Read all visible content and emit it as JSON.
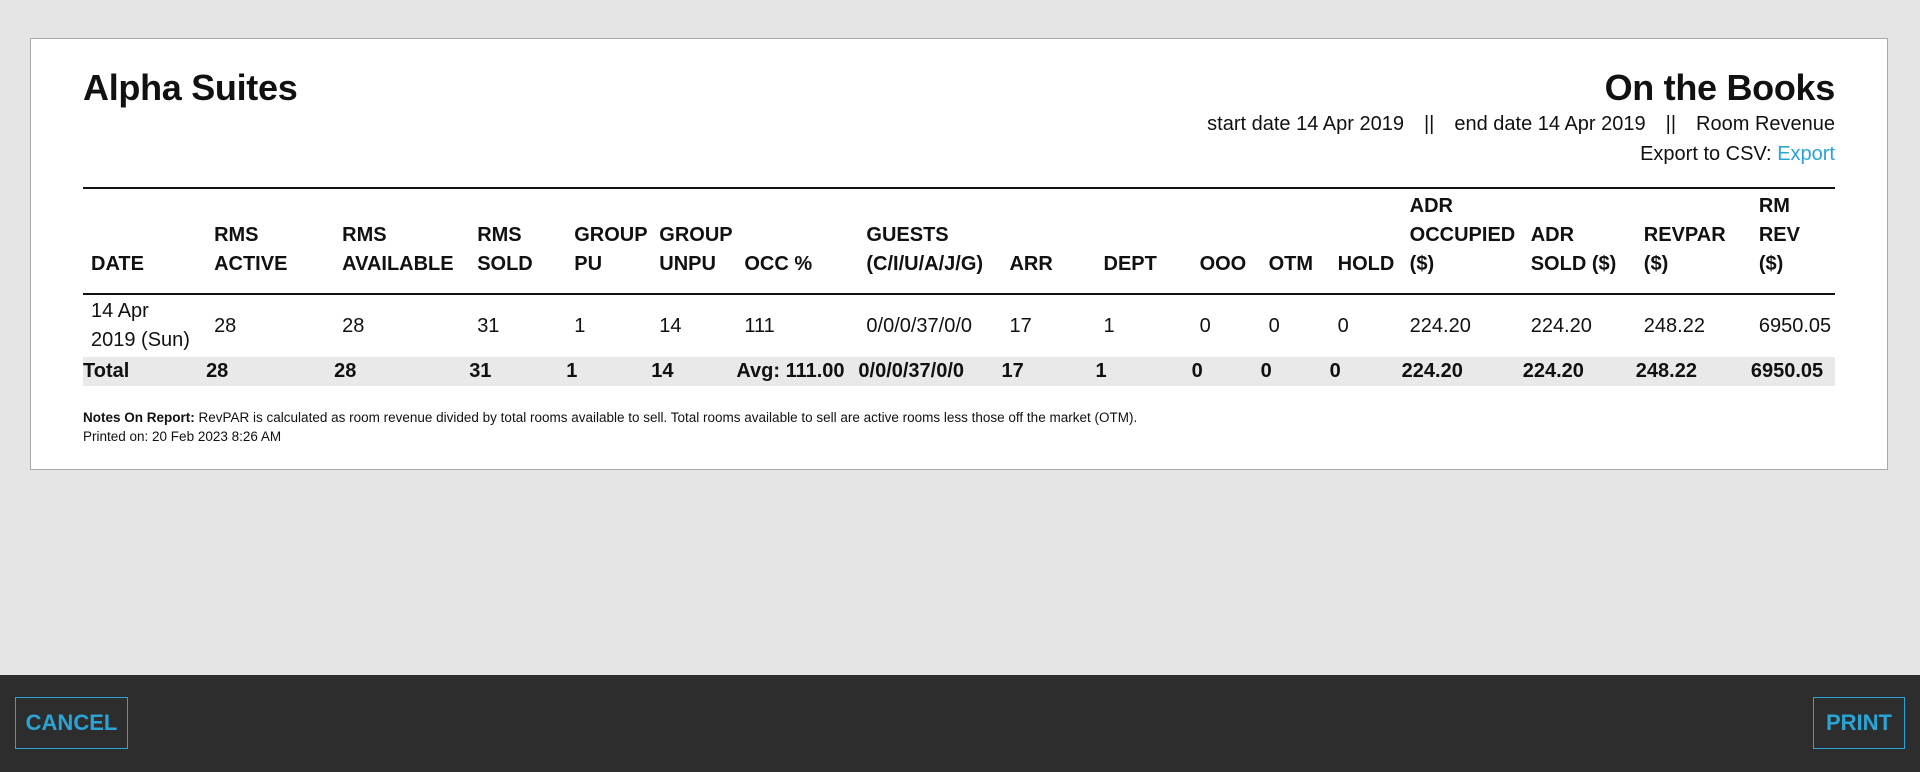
{
  "report": {
    "hotel_name": "Alpha Suites",
    "title": "On the Books",
    "start_date_label": "start date 14 Apr 2019",
    "end_date_label": "end date 14 Apr 2019",
    "revenue_type": "Room Revenue",
    "separator": "||",
    "export_label": "Export to CSV:",
    "export_link": "Export"
  },
  "table": {
    "headers": [
      [
        "DATE"
      ],
      [
        "RMS",
        "ACTIVE"
      ],
      [
        "RMS",
        "AVAILABLE"
      ],
      [
        "RMS",
        "SOLD"
      ],
      [
        "GROUP",
        "PU"
      ],
      [
        "GROUP",
        "UNPU"
      ],
      [
        "OCC %"
      ],
      [
        "GUESTS",
        "(C/I/U/A/J/G)"
      ],
      [
        "ARR"
      ],
      [
        "DEPT"
      ],
      [
        "OOO"
      ],
      [
        "OTM"
      ],
      [
        "HOLD"
      ],
      [
        "ADR",
        "OCCUPIED",
        "($)"
      ],
      [
        "ADR",
        "SOLD ($)"
      ],
      [
        "REVPAR",
        "($)"
      ],
      [
        "RM REV",
        "($)"
      ]
    ],
    "rows": [
      {
        "date_line1": "14 Apr",
        "date_line2": "2019 (Sun)",
        "cells": [
          "28",
          "28",
          "31",
          "1",
          "14",
          "111",
          "0/0/0/37/0/0",
          "17",
          "1",
          "0",
          "0",
          "0",
          "224.20",
          "224.20",
          "248.22",
          "6950.05"
        ]
      }
    ],
    "total": {
      "label": "Total",
      "cells": [
        "28",
        "28",
        "31",
        "1",
        "14",
        "Avg: 111.00",
        "0/0/0/37/0/0",
        "17",
        "1",
        "0",
        "0",
        "0",
        "224.20",
        "224.20",
        "248.22",
        "6950.05"
      ]
    }
  },
  "notes": {
    "label": "Notes On Report:",
    "text": "RevPAR is calculated as room revenue divided by total rooms available to sell. Total rooms available to sell are active rooms less those off the market (OTM).",
    "printed_on": "Printed on: 20 Feb 2023 8:26 AM"
  },
  "footer": {
    "cancel_label": "CANCEL",
    "print_label": "PRINT"
  },
  "colors": {
    "accent": "#2aa4d5",
    "footer_bg": "#2d2d2d",
    "page_bg": "#e5e5e5"
  }
}
